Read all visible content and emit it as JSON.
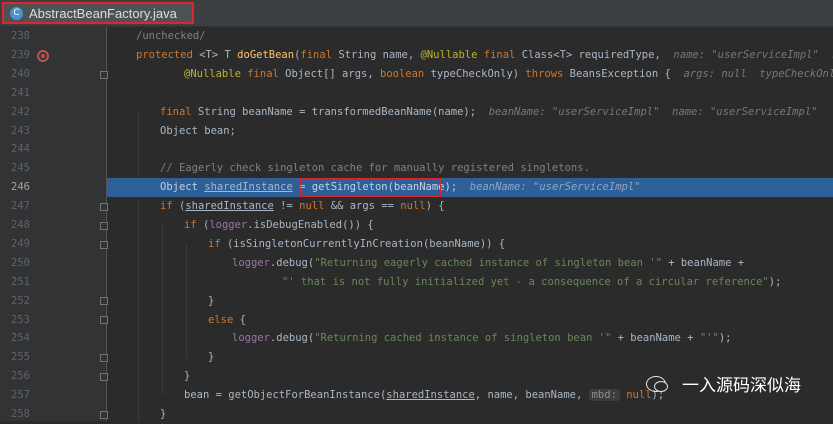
{
  "tab": {
    "title": "AbstractBeanFactory.java",
    "icon": "class-icon",
    "icon_letter": "C"
  },
  "gutter": {
    "line_numbers": [
      "238",
      "239",
      "240",
      "241",
      "242",
      "243",
      "244",
      "245",
      "246",
      "247",
      "248",
      "249",
      "250",
      "251",
      "252",
      "253",
      "254",
      "255",
      "256",
      "257",
      "258"
    ]
  },
  "code": {
    "l238": "/unchecked/",
    "l239_kw": "protected",
    "l239_type": "<T> T",
    "l239_fn": "doGetBean",
    "l239_rest1": "(",
    "l239_final": "final",
    "l239_rest2": " String name, ",
    "l239_ann": "@Nullable",
    "l239_final2": " final",
    "l239_rest3": " Class<T> requiredType,",
    "l239_hint": "  name: \"userServiceImpl\"  requir",
    "l240_ann": "@Nullable",
    "l240_final": " final",
    "l240_rest": " Object[] args, ",
    "l240_bool": "boolean",
    "l240_rest2": " typeCheckOnly) ",
    "l240_throws": "throws",
    "l240_rest3": " BeansException {",
    "l240_hint": "  args: null  typeCheckOnly: fa",
    "l242_final": "final",
    "l242_rest": " String beanName = transformedBeanName(name);",
    "l242_hint": "  beanName: \"userServiceImpl\"  name: \"userServiceImpl\"",
    "l243": "Object bean;",
    "l245": "// Eagerly check singleton cache for manually registered singletons.",
    "l246_a": "Object ",
    "l246_b": "sharedInstance",
    "l246_c": " = ",
    "l246_d": "getSingleton(beanName);",
    "l246_hint": "  beanName: \"userServiceImpl\"",
    "l247_if": "if",
    "l247_a": " (",
    "l247_b": "sharedInstance",
    "l247_c": " != ",
    "l247_null": "null",
    "l247_d": " && args == ",
    "l247_null2": "null",
    "l247_e": ") {",
    "l248_if": "if",
    "l248_a": " (",
    "l248_log": "logger",
    "l248_b": ".isDebugEnabled()) {",
    "l249_if": "if",
    "l249_a": " (isSingletonCurrentlyInCreation(beanName)) {",
    "l250_log": "logger",
    "l250_a": ".debug(",
    "l250_str": "\"Returning eagerly cached instance of singleton bean '\"",
    "l250_b": " + beanName +",
    "l251_str": "\"' that is not fully initialized yet - a consequence of a circular reference\"",
    "l251_b": ");",
    "l252": "}",
    "l253_else": "else",
    "l253_a": " {",
    "l254_log": "logger",
    "l254_a": ".debug(",
    "l254_str": "\"Returning cached instance of singleton bean '\"",
    "l254_b": " + beanName + ",
    "l254_str2": "\"'\"",
    "l254_c": ");",
    "l255": "}",
    "l256": "}",
    "l257_a": "bean = getObjectForBeanInstance(",
    "l257_b": "sharedInstance",
    "l257_c": ", name, beanName, ",
    "l257_hint": "mbd:",
    "l257_null": " null",
    "l257_d": ");",
    "l258": "}"
  },
  "watermark": {
    "text": "一入源码深似海"
  },
  "colors": {
    "highlight_line": "#2d6099",
    "red_box": "#e0242d",
    "background": "#2b2b2b"
  }
}
